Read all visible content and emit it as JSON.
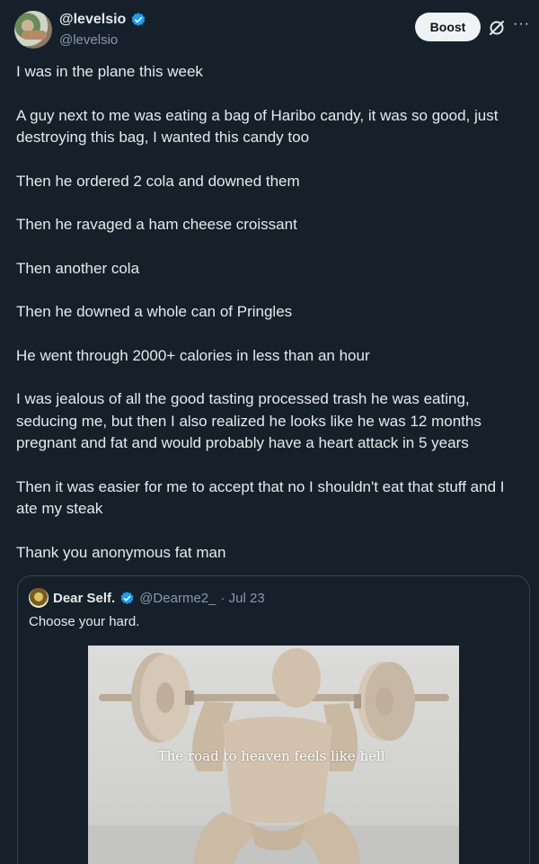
{
  "author": {
    "display_name": "@levelsio",
    "handle": "@levelsio"
  },
  "header": {
    "boost_label": "Boost",
    "more_label": "···"
  },
  "post": {
    "paragraphs": [
      "I was in the plane this week",
      "A guy next to me was eating a bag of Haribo candy, it was so good, just\ndestroying this bag, I wanted this candy too",
      "Then he ordered 2 cola and downed them",
      "Then he ravaged a ham cheese croissant",
      "Then another cola",
      "Then he downed a whole can of Pringles",
      "He went through 2000+ calories in less than an hour",
      "I was jealous of all the good tasting processed trash he was eating,\nseducing me, but then I also realized he looks like he was 12 months\npregnant and fat and would probably have a heart attack in 5 years",
      "Then it was easier for me to accept that no I shouldn't eat that stuff and I\nate my steak",
      "Thank you anonymous fat man"
    ]
  },
  "quote": {
    "display_name": "Dear Self.",
    "handle": "@Dearme2_",
    "date": "· Jul 23",
    "text": "Choose your hard.",
    "image_caption": "The road to heaven feels like hell."
  },
  "colors": {
    "background": "#15202b",
    "text": "#e7e9ea",
    "muted": "#8b98a5",
    "verified": "#1d9bf0",
    "border": "#38444d"
  }
}
